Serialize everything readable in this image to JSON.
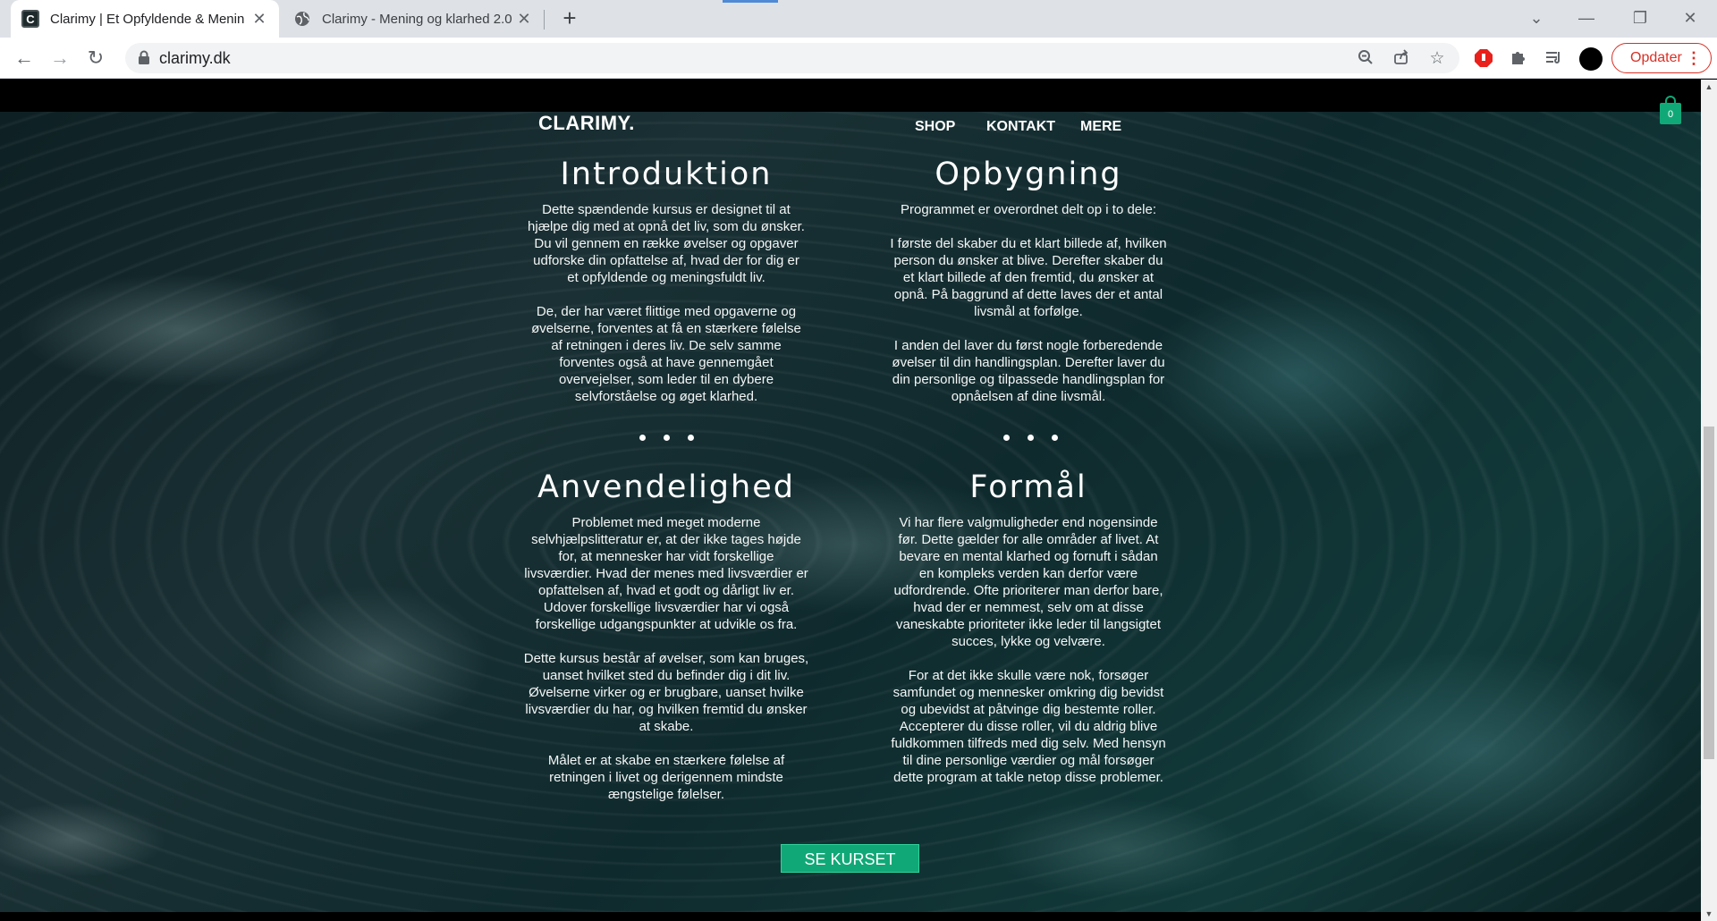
{
  "browser": {
    "tabs": [
      {
        "title": "Clarimy | Et Opfyldende & Menin"
      },
      {
        "title": "Clarimy - Mening og klarhed 2.0"
      }
    ],
    "url": "clarimy.dk",
    "update_label": "Opdater"
  },
  "site": {
    "brand": "CLARIMY.",
    "nav": [
      "SHOP",
      "KONTAKT",
      "MERE"
    ],
    "cart_count": "0",
    "sections": {
      "introduktion": {
        "title": "Introduktion",
        "paragraphs": [
          "Dette spændende kursus er designet til at hjælpe dig med at opnå det liv, som du ønsker. Du vil gennem en række øvelser og opgaver udforske din opfattelse af, hvad der for dig er et opfyldende og meningsfuldt liv.",
          "De, der har været flittige med opgaverne og øvelserne, forventes at få en stærkere følelse af retningen i deres liv. De selv samme forventes også at have gennemgået overvejelser, som leder til en dybere selvforståelse og øget klarhed."
        ]
      },
      "opbygning": {
        "title": "Opbygning",
        "paragraphs": [
          "Programmet er overordnet delt op i to dele:",
          "I første del skaber du et klart billede af, hvilken person du ønsker at blive. Derefter skaber du et klart billede af den fremtid, du ønsker at opnå. På baggrund af dette laves der et antal livsmål at forfølge.",
          "I anden del laver du først nogle forberedende øvelser til din handlingsplan. Derefter laver du din personlige og tilpassede handlingsplan for opnåelsen af dine livsmål."
        ]
      },
      "anvendelighed": {
        "title": "Anvendelighed",
        "paragraphs": [
          "Problemet med meget moderne selvhjælpslitteratur er, at der ikke tages højde for, at mennesker har vidt forskellige livsværdier. Hvad der menes med livsværdier er opfattelsen af, hvad et godt og dårligt liv er. Udover forskellige livsværdier har vi også forskellige udgangspunkter at udvikle os fra.",
          "Dette kursus består af øvelser, som kan bruges, uanset hvilket sted du befinder dig i dit liv. Øvelserne virker og er brugbare, uanset hvilke livsværdier du har, og hvilken fremtid du ønsker at skabe.",
          "Målet er at skabe en stærkere følelse af retningen i livet og derigennem mindste ængstelige følelser."
        ]
      },
      "formaal": {
        "title": "Formål",
        "paragraphs": [
          "Vi har flere valgmuligheder end nogensinde før. Dette gælder for alle områder af livet. At bevare en mental klarhed og fornuft i sådan en kompleks verden kan derfor være udfordrende. Ofte prioriterer man derfor bare, hvad der er nemmest, selv om at disse vaneskabte prioriteter ikke leder til langsigtet succes, lykke og velvære.",
          "For at det ikke skulle være nok, forsøger samfundet og mennesker omkring dig bevidst og ubevidst at påtvinge dig bestemte roller. Accepterer du disse roller, vil du aldrig blive fuldkommen tilfreds med dig selv. Med hensyn til dine personlige værdier og mål forsøger dette program at takle netop disse problemer."
        ]
      }
    },
    "cta_label": "SE KURSET"
  },
  "colors": {
    "accent": "#11a877",
    "update_red": "#d93025"
  }
}
